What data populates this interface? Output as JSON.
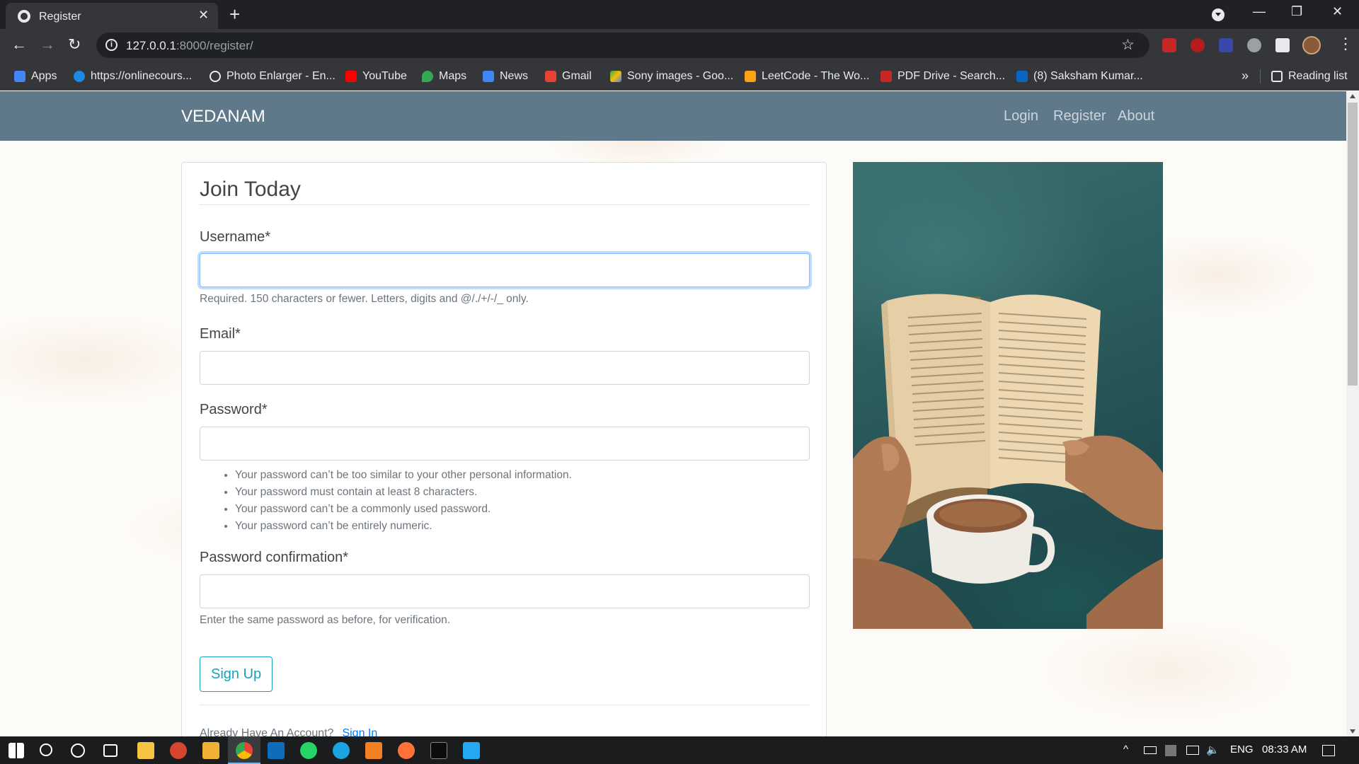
{
  "browser": {
    "tab_title": "Register",
    "new_tab": "+",
    "close_tab": "✕",
    "url_host": "127.0.0.1",
    "url_path": ":8000/register/",
    "reading_list": "Reading list",
    "more_bookmarks": "»",
    "bookmarks": [
      {
        "label": "Apps",
        "icon": "apps-grid-icon",
        "color": "#4285f4"
      },
      {
        "label": "https://onlinecours...",
        "icon": "site-icon",
        "color": "#1e88e5"
      },
      {
        "label": "Photo Enlarger - En...",
        "icon": "search-icon",
        "color": "#e8eaed"
      },
      {
        "label": "YouTube",
        "icon": "youtube-icon",
        "color": "#ff0000"
      },
      {
        "label": "Maps",
        "icon": "maps-icon",
        "color": "#34a853"
      },
      {
        "label": "News",
        "icon": "news-icon",
        "color": "#4285f4"
      },
      {
        "label": "Gmail",
        "icon": "gmail-icon",
        "color": "#ea4335"
      },
      {
        "label": "Sony images - Goo...",
        "icon": "drive-icon",
        "color": "#fbbc04"
      },
      {
        "label": "LeetCode - The Wo...",
        "icon": "leetcode-icon",
        "color": "#ffa116"
      },
      {
        "label": "PDF Drive - Search...",
        "icon": "pdfdrive-icon",
        "color": "#c62828"
      },
      {
        "label": "(8) Saksham Kumar...",
        "icon": "linkedin-icon",
        "color": "#0a66c2"
      }
    ]
  },
  "site": {
    "brand": "VEDANAM",
    "nav": [
      {
        "label": "Login"
      },
      {
        "label": "Register"
      },
      {
        "label": "About"
      }
    ]
  },
  "form": {
    "title": "Join Today",
    "username_label": "Username*",
    "username_value": "",
    "username_help": "Required. 150 characters or fewer. Letters, digits and @/./+/-/_ only.",
    "email_label": "Email*",
    "email_value": "",
    "password_label": "Password*",
    "password_value": "",
    "password_rules": [
      "Your password can’t be too similar to your other personal information.",
      "Your password must contain at least 8 characters.",
      "Your password can’t be a commonly used password.",
      "Your password can’t be entirely numeric."
    ],
    "confirm_label": "Password confirmation*",
    "confirm_value": "",
    "confirm_help": "Enter the same password as before, for verification.",
    "submit_label": "Sign Up",
    "already_text": "Already Have An Account?",
    "signin_link": "Sign In"
  },
  "taskbar": {
    "language": "ENG",
    "time": "08:33 AM"
  }
}
